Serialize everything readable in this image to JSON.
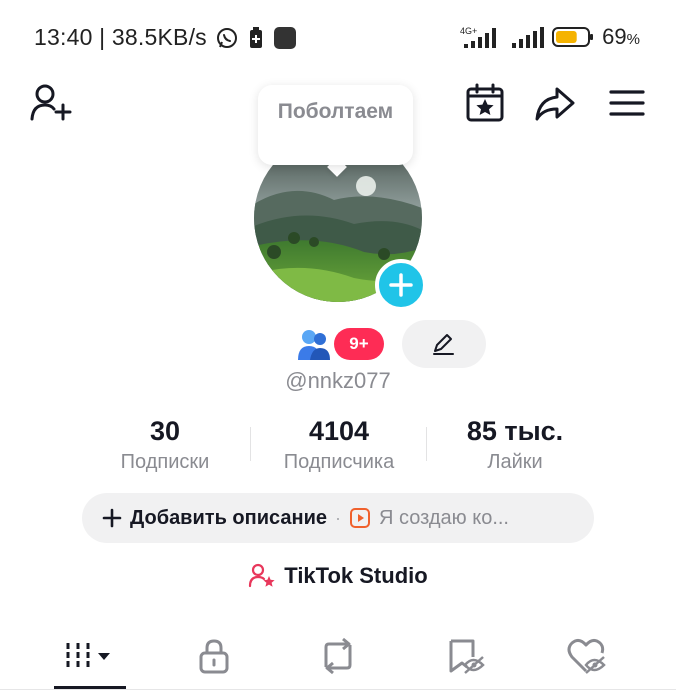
{
  "status_bar": {
    "time": "13:40",
    "speed": "38.5KB/s",
    "network": "4G+",
    "battery_percent": "69",
    "battery_percent_sign": "%",
    "battery_level": 0.69,
    "icons": [
      "whatsapp-icon",
      "battery-saver-icon",
      "app-icon",
      "signal-icon",
      "signal-icon",
      "battery-icon"
    ]
  },
  "header": {
    "icons": [
      "add-friend-icon",
      "calendar-star-icon",
      "share-icon",
      "menu-icon"
    ]
  },
  "tooltip": {
    "text": "Поболтаем"
  },
  "profile": {
    "username": "@nnkz077",
    "notification_badge": "9+"
  },
  "stats": [
    {
      "value": "30",
      "label": "Подписки"
    },
    {
      "value": "4104",
      "label": "Подписчика"
    },
    {
      "value": "85 тыс.",
      "label": "Лайки"
    }
  ],
  "description": {
    "add_label": "Добавить описание",
    "separator": "·",
    "creator_label": "Я создаю ко..."
  },
  "studio": {
    "label": "TikTok Studio"
  },
  "tabs": [
    {
      "icon": "grid-icon"
    },
    {
      "icon": "lock-icon"
    },
    {
      "icon": "repost-icon"
    },
    {
      "icon": "favorites-icon"
    },
    {
      "icon": "liked-icon"
    }
  ],
  "colors": {
    "accent": "#fe2c55",
    "cyan": "#20c4e8",
    "text_primary": "#161823",
    "text_secondary": "#8a8b91",
    "pill_bg": "#f1f1f2"
  }
}
